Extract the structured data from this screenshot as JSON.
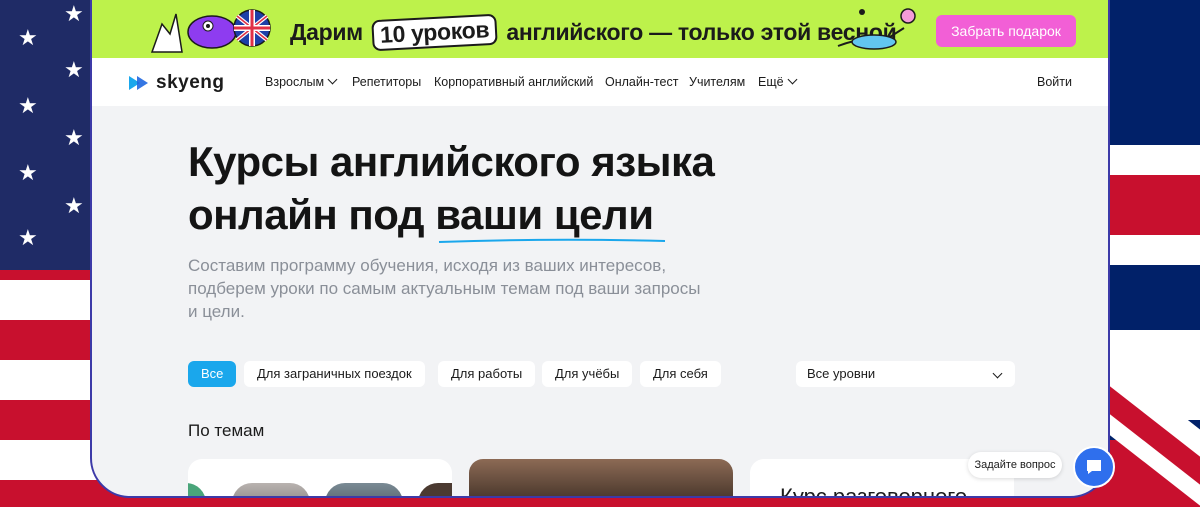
{
  "promo": {
    "text_before": "Дарим",
    "boxed": "10 уроков",
    "text_after": "английского — только этой весной",
    "button": "Забрать подарок"
  },
  "nav": {
    "logo": "skyeng",
    "items": [
      {
        "label": "Взрослым",
        "dropdown": true
      },
      {
        "label": "Репетиторы"
      },
      {
        "label": "Корпоративный английский"
      },
      {
        "label": "Онлайн-тест"
      },
      {
        "label": "Учителям"
      },
      {
        "label": "Ещё",
        "dropdown": true
      }
    ],
    "login": "Войти"
  },
  "hero": {
    "title_line1": "Курсы английского языка",
    "title_line2_plain": "онлайн под ",
    "title_line2_highlight": "ваши цели",
    "subtitle": "Составим программу обучения, исходя из ваших интересов, подберем уроки по самым актуальным темам под ваши запросы и цели."
  },
  "filters": {
    "chips": [
      "Все",
      "Для заграничных поездок",
      "Для работы",
      "Для учёбы",
      "Для себя"
    ],
    "active": "Все",
    "level_select": "Все уровни"
  },
  "section": {
    "title": "По темам"
  },
  "cards": {
    "third_title": "Курс разговорного"
  },
  "chat": {
    "ask_label": "Задайте вопрос"
  },
  "colors": {
    "promo_bg": "#bdf24b",
    "promo_button": "#f25fd6",
    "accent": "#1aa7ec",
    "card_border": "#3d3aa8",
    "chat": "#2f6fed"
  }
}
